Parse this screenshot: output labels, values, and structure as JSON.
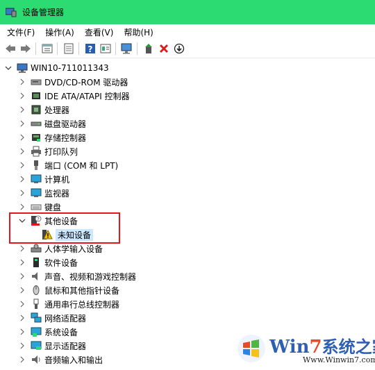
{
  "window": {
    "title": "设备管理器",
    "colors": {
      "titlebar": "#2cdc72",
      "highlight": "#e5141d",
      "selection": "#cce8ff"
    }
  },
  "menu": [
    {
      "label": "文件(F)"
    },
    {
      "label": "操作(A)"
    },
    {
      "label": "查看(V)"
    },
    {
      "label": "帮助(H)"
    }
  ],
  "toolbar": [
    "back-icon",
    "forward-icon",
    "properties-icon",
    "update-icon",
    "help-icon",
    "details-icon",
    "scan-icon",
    "enable-icon",
    "uninstall-icon",
    "download-icon"
  ],
  "tree": {
    "root": "WIN10-711011343",
    "categories": [
      {
        "label": "DVD/CD-ROM 驱动器",
        "icon": "dvd-icon"
      },
      {
        "label": "IDE ATA/ATAPI 控制器",
        "icon": "ide-icon"
      },
      {
        "label": "处理器",
        "icon": "cpu-icon"
      },
      {
        "label": "磁盘驱动器",
        "icon": "disk-icon"
      },
      {
        "label": "存储控制器",
        "icon": "storage-icon"
      },
      {
        "label": "打印队列",
        "icon": "printer-icon"
      },
      {
        "label": "端口 (COM 和 LPT)",
        "icon": "port-icon"
      },
      {
        "label": "计算机",
        "icon": "computer-icon"
      },
      {
        "label": "监视器",
        "icon": "monitor-icon"
      },
      {
        "label": "键盘",
        "icon": "keyboard-icon"
      },
      {
        "label": "其他设备",
        "icon": "other-device-icon",
        "expanded": true
      },
      {
        "label": "人体学输入设备",
        "icon": "hid-icon"
      },
      {
        "label": "软件设备",
        "icon": "software-icon"
      },
      {
        "label": "声音、视频和游戏控制器",
        "icon": "sound-icon"
      },
      {
        "label": "鼠标和其他指针设备",
        "icon": "mouse-icon"
      },
      {
        "label": "通用串行总线控制器",
        "icon": "usb-icon"
      },
      {
        "label": "网络适配器",
        "icon": "network-icon"
      },
      {
        "label": "系统设备",
        "icon": "system-icon"
      },
      {
        "label": "显示适配器",
        "icon": "display-icon"
      },
      {
        "label": "音频输入和输出",
        "icon": "audio-icon"
      }
    ],
    "unknown_device": "未知设备"
  },
  "watermark": {
    "brand_a": "Win",
    "brand_b": "7",
    "brand_c": "系统之家",
    "url": "Www.Winwin7.com"
  }
}
